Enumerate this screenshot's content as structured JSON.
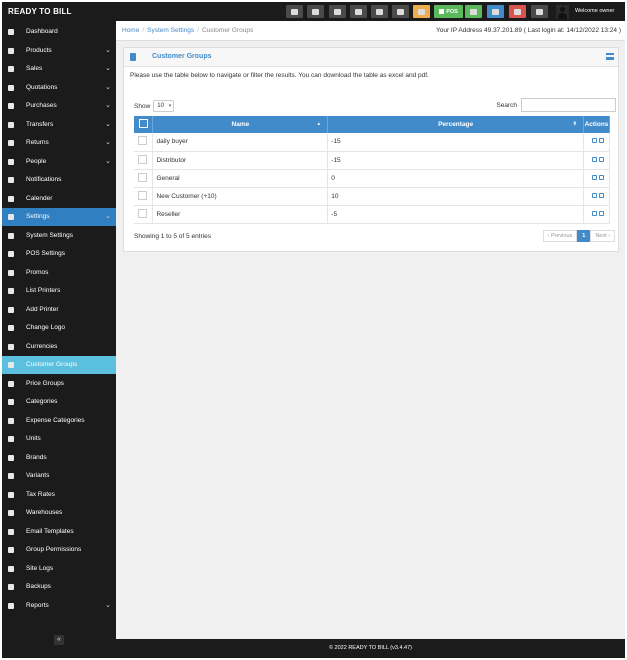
{
  "app": {
    "brand": "READY TO BILL",
    "welcome": "Welcome owner"
  },
  "topbar": {
    "buttons": [
      {
        "name": "dashboard-shortcut",
        "label": "",
        "color": "#4a4a4a"
      },
      {
        "name": "settings-shortcut",
        "label": "",
        "color": "#4a4a4a"
      },
      {
        "name": "calculator-shortcut",
        "label": "",
        "color": "#4a4a4a"
      },
      {
        "name": "calendar-shortcut",
        "label": "",
        "color": "#4a4a4a"
      },
      {
        "name": "notes-shortcut",
        "label": "",
        "color": "#4a4a4a"
      },
      {
        "name": "language-shortcut",
        "label": "",
        "color": "#4a4a4a"
      },
      {
        "name": "alerts-shortcut",
        "label": "",
        "color": "#f0ad4e"
      },
      {
        "name": "pos-button",
        "label": "POS",
        "color": "#5cb85c"
      },
      {
        "name": "today-sales-shortcut",
        "label": "",
        "color": "#5cb85c"
      },
      {
        "name": "list-shortcut",
        "label": "",
        "color": "#428bca"
      },
      {
        "name": "sync-shortcut",
        "label": "",
        "color": "#d9534f"
      },
      {
        "name": "grid-shortcut",
        "label": "",
        "color": "#4a4a4a"
      }
    ]
  },
  "sidebar": {
    "items": [
      {
        "label": "Dashboard",
        "chevron": false
      },
      {
        "label": "Products",
        "chevron": true
      },
      {
        "label": "Sales",
        "chevron": true
      },
      {
        "label": "Quotations",
        "chevron": true
      },
      {
        "label": "Purchases",
        "chevron": true
      },
      {
        "label": "Transfers",
        "chevron": true
      },
      {
        "label": "Returns",
        "chevron": true
      },
      {
        "label": "People",
        "chevron": true
      },
      {
        "label": "Notifications",
        "chevron": false
      },
      {
        "label": "Calender",
        "chevron": false
      },
      {
        "label": "Settings",
        "chevron": true,
        "state": "active"
      },
      {
        "label": "System Settings",
        "chevron": false
      },
      {
        "label": "POS Settings",
        "chevron": false
      },
      {
        "label": "Promos",
        "chevron": false
      },
      {
        "label": "List Printers",
        "chevron": false
      },
      {
        "label": "Add Printer",
        "chevron": false
      },
      {
        "label": "Change Logo",
        "chevron": false
      },
      {
        "label": "Currencies",
        "chevron": false
      },
      {
        "label": "Customer Groups",
        "chevron": false,
        "state": "current"
      },
      {
        "label": "Price Groups",
        "chevron": false
      },
      {
        "label": "Categories",
        "chevron": false
      },
      {
        "label": "Expense Categories",
        "chevron": false
      },
      {
        "label": "Units",
        "chevron": false
      },
      {
        "label": "Brands",
        "chevron": false
      },
      {
        "label": "Variants",
        "chevron": false
      },
      {
        "label": "Tax Rates",
        "chevron": false
      },
      {
        "label": "Warehouses",
        "chevron": false
      },
      {
        "label": "Email Templates",
        "chevron": false
      },
      {
        "label": "Group Permissions",
        "chevron": false
      },
      {
        "label": "Site Logs",
        "chevron": false
      },
      {
        "label": "Backups",
        "chevron": false
      },
      {
        "label": "Reports",
        "chevron": true
      }
    ],
    "collapse_glyph": "«"
  },
  "breadcrumb": {
    "home": "Home",
    "section": "System Settings",
    "current": "Customer Groups"
  },
  "ip_info": "Your IP Address 49.37.201.89 ( Last login at: 14/12/2022 13:24 )",
  "panel": {
    "title": "Customer Groups",
    "intro": "Please use the table below to navigate or filter the results. You can download the table as excel and pdf."
  },
  "table_controls": {
    "show_label": "Show",
    "page_size": "10",
    "search_label": "Search",
    "search_value": ""
  },
  "table": {
    "headers": {
      "name": "Name",
      "percentage": "Percentage",
      "actions": "Actions"
    },
    "rows": [
      {
        "name": "daily buyer",
        "percentage": "-15"
      },
      {
        "name": "Distributor",
        "percentage": "-15"
      },
      {
        "name": "General",
        "percentage": "0"
      },
      {
        "name": "New Customer (+10)",
        "percentage": "10"
      },
      {
        "name": "Reseller",
        "percentage": "-5"
      }
    ]
  },
  "pagination": {
    "info": "Showing 1 to 5 of 5 entries",
    "prev": "‹ Previous",
    "current": "1",
    "next": "Next ›"
  },
  "footer": {
    "text": "© 2022 READY TO BILL (v3.4.47)"
  },
  "colors": {
    "accent": "#428bca",
    "sidebar_active": "#2f7fc1",
    "sidebar_current": "#5bc0de"
  }
}
